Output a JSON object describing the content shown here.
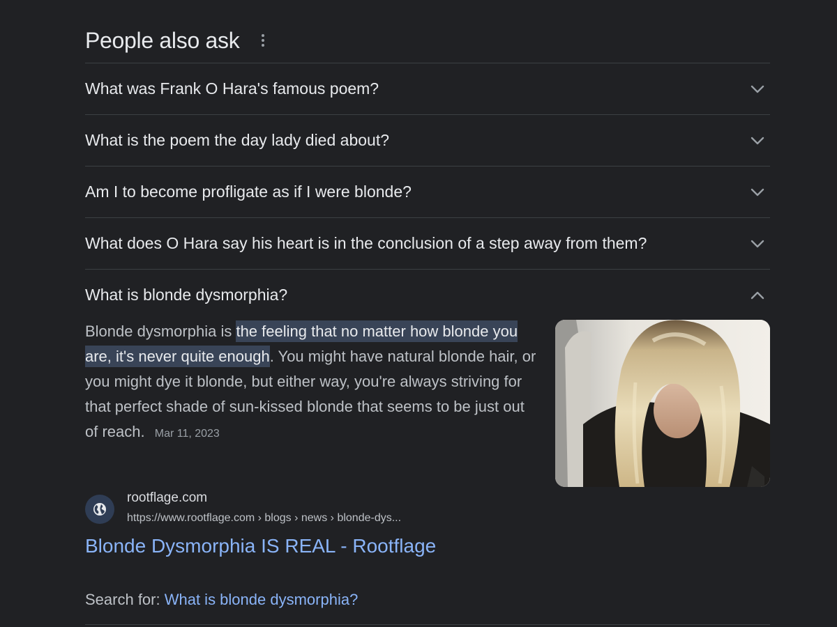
{
  "paa": {
    "title": "People also ask"
  },
  "questions": [
    {
      "text": "What was Frank O Hara's famous poem?",
      "expanded": false
    },
    {
      "text": "What is the poem the day lady died about?",
      "expanded": false
    },
    {
      "text": "Am I to become profligate as if I were blonde?",
      "expanded": false
    },
    {
      "text": "What does O Hara say his heart is in the conclusion of a step away from them?",
      "expanded": false
    },
    {
      "text": "What is blonde dysmorphia?",
      "expanded": true
    }
  ],
  "answer": {
    "prefix": "Blonde dysmorphia is ",
    "highlight": "the feeling that no matter how blonde you are, it's never quite enough",
    "suffix": ". You might have natural blonde hair, or you might dye it blonde, but either way, you're always striving for that perfect shade of sun-kissed blonde that seems to be just out of reach.",
    "date": "Mar 11, 2023"
  },
  "source": {
    "site_name": "rootflage.com",
    "url": "https://www.rootflage.com › blogs › news › blonde-dys...",
    "title": "Blonde Dysmorphia IS REAL - Rootflage"
  },
  "search_for": {
    "label": "Search for: ",
    "query": "What is blonde dysmorphia?"
  },
  "colors": {
    "background": "#202124",
    "link": "#8ab4f8",
    "highlight": "#394457"
  }
}
